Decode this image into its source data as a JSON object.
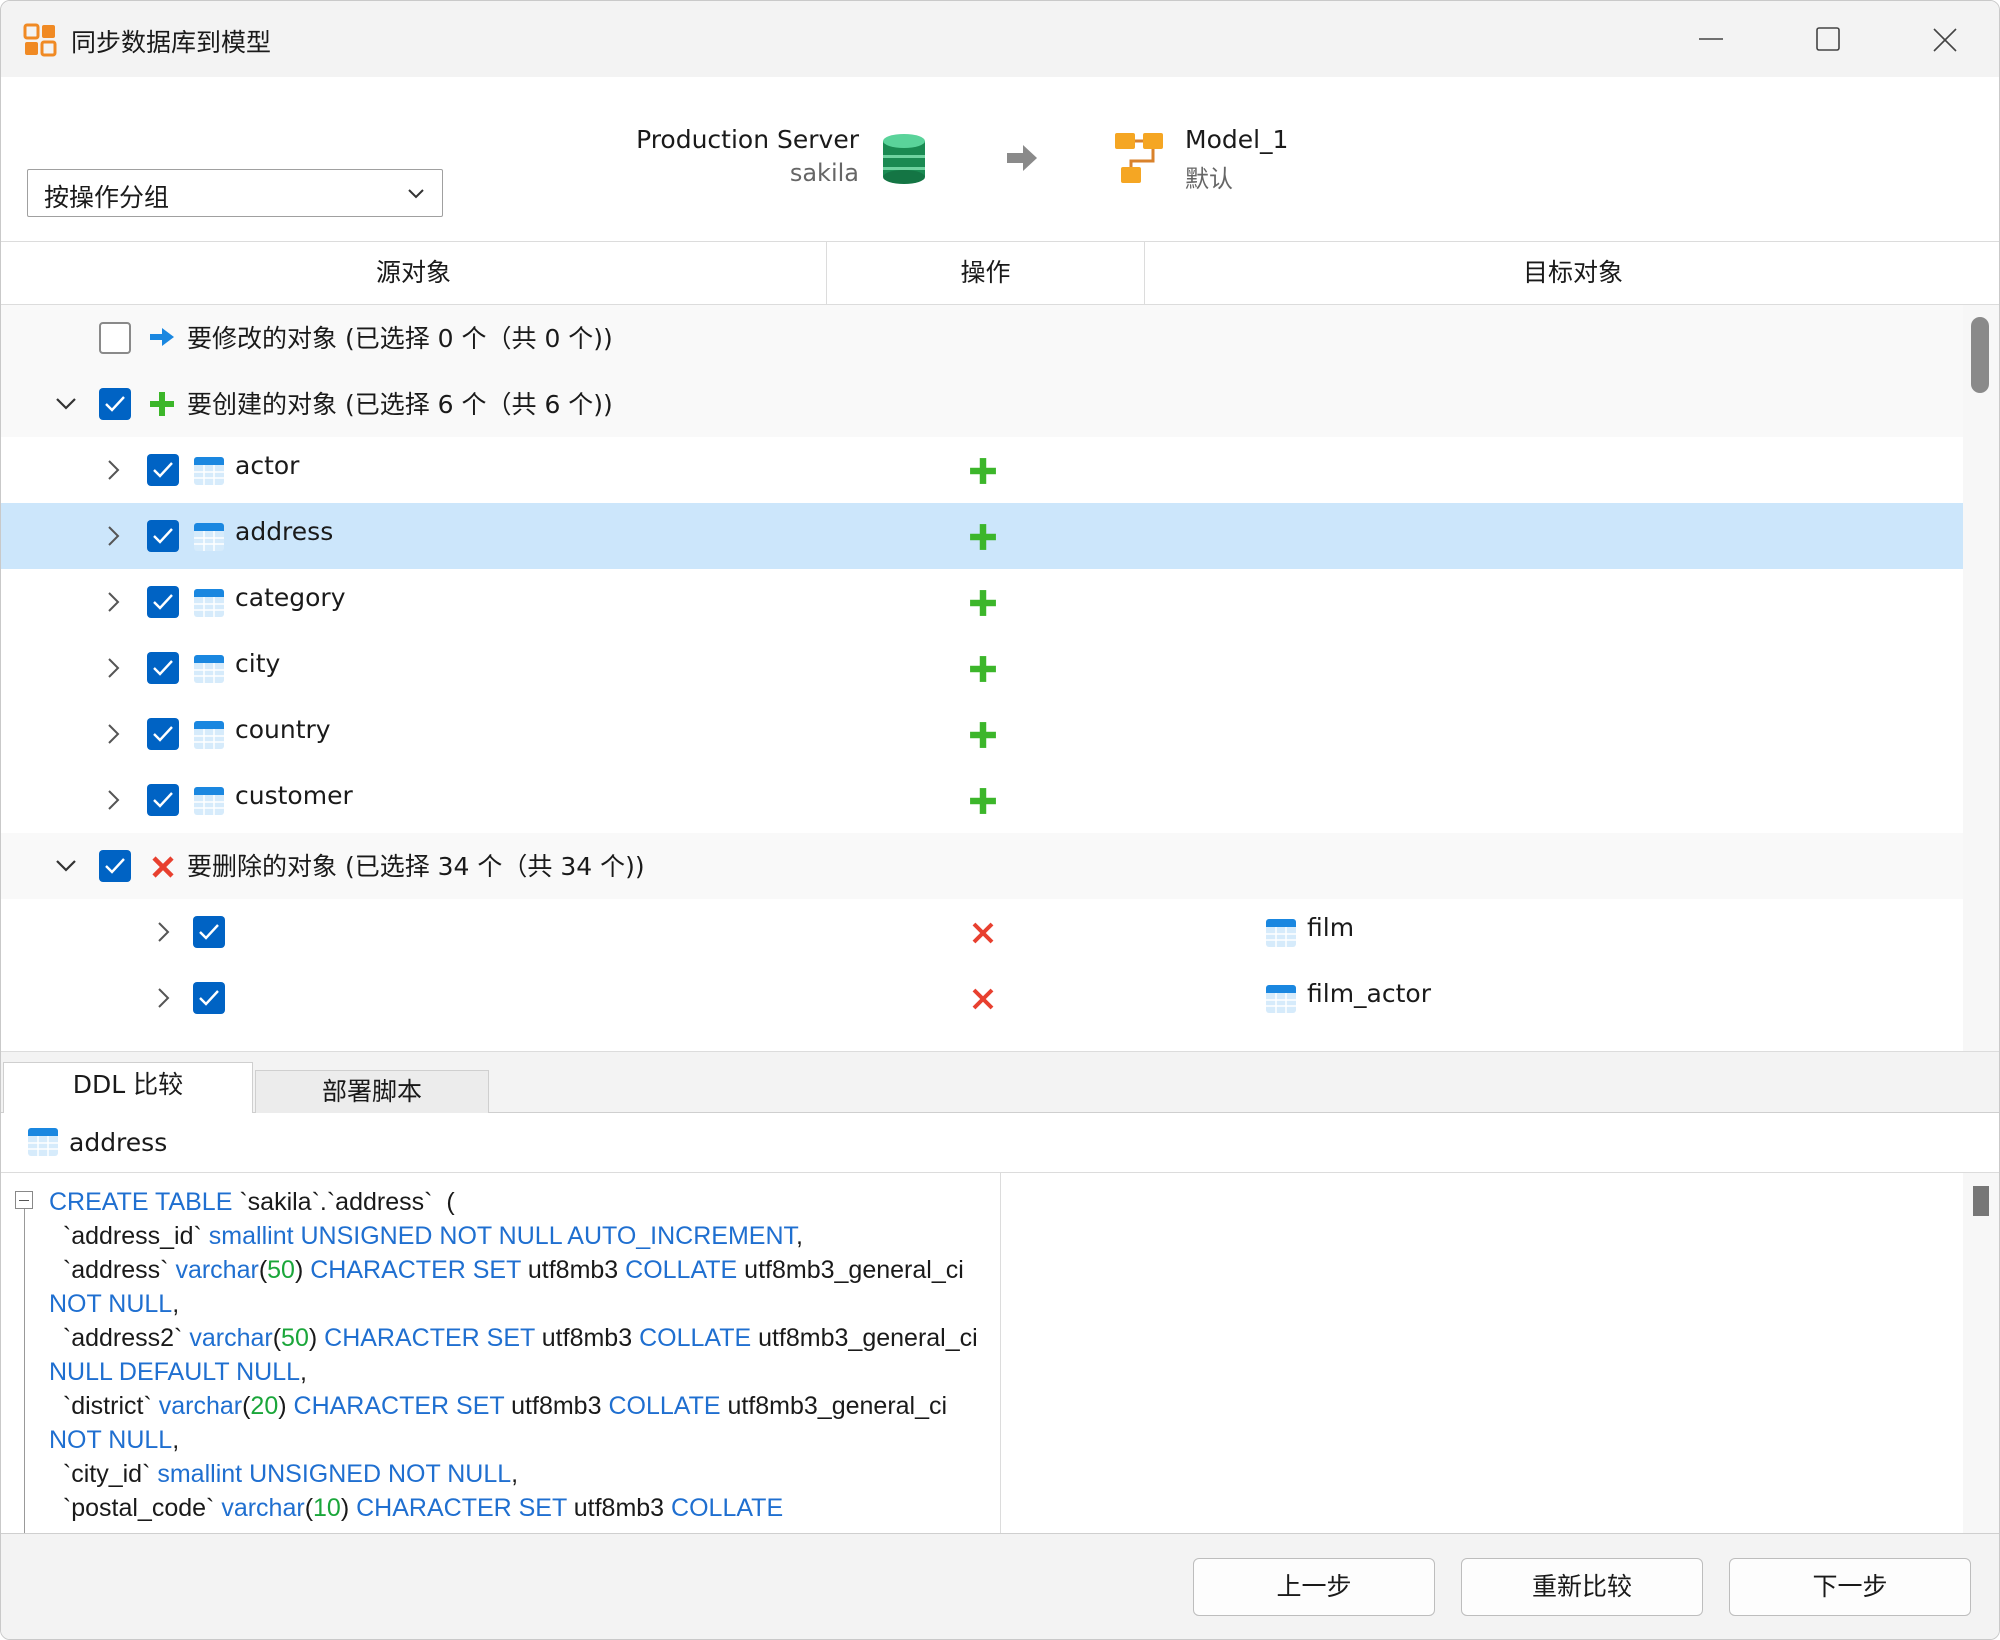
{
  "window": {
    "title": "同步数据库到模型",
    "controls": [
      "minimize-icon",
      "maximize-icon",
      "close-icon"
    ]
  },
  "header": {
    "group_select": "按操作分组",
    "source_name": "Production Server",
    "source_db": "sakila",
    "target_name": "Model_1",
    "target_sub": "默认"
  },
  "columns": {
    "source": "源对象",
    "operation": "操作",
    "target": "目标对象"
  },
  "tree": {
    "groups": [
      {
        "label": "要修改的对象 (已选择 0 个（共 0 个))",
        "checked": false,
        "icon": "arrow-right-icon",
        "expanded": false
      },
      {
        "label": "要创建的对象 (已选择 6 个（共 6 个))",
        "checked": true,
        "icon": "plus-icon",
        "expanded": true
      },
      {
        "label": "要删除的对象 (已选择 34 个（共 34 个))",
        "checked": true,
        "icon": "x-icon",
        "expanded": true
      }
    ],
    "create_items": [
      "actor",
      "address",
      "category",
      "city",
      "country",
      "customer"
    ],
    "delete_items": [
      "film",
      "film_actor"
    ],
    "selected_item": "address"
  },
  "tabs": {
    "ddl_compare": "DDL 比较",
    "deploy_script": "部署脚本",
    "active": "DDL 比较"
  },
  "ddl": {
    "object_name": "address",
    "lines": [
      "CREATE TABLE `sakila`.`address`  (",
      "  `address_id` smallint UNSIGNED NOT NULL AUTO_INCREMENT,",
      "  `address` varchar(50) CHARACTER SET utf8mb3 COLLATE utf8mb3_general_ci",
      "NOT NULL,",
      "  `address2` varchar(50) CHARACTER SET utf8mb3 COLLATE utf8mb3_general_ci",
      "NULL DEFAULT NULL,",
      "  `district` varchar(20) CHARACTER SET utf8mb3 COLLATE utf8mb3_general_ci",
      "NOT NULL,",
      "  `city_id` smallint UNSIGNED NOT NULL,",
      "  `postal_code` varchar(10) CHARACTER SET utf8mb3 COLLATE"
    ]
  },
  "footer": {
    "prev": "上一步",
    "recompare": "重新比较",
    "next": "下一步"
  },
  "colors": {
    "accent": "#0063c4",
    "selected_row": "#cce6fb",
    "create_green": "#3cb62a",
    "delete_red": "#e8402f",
    "keyword_blue": "#1f6fd0",
    "number_green": "#1aa63a"
  }
}
